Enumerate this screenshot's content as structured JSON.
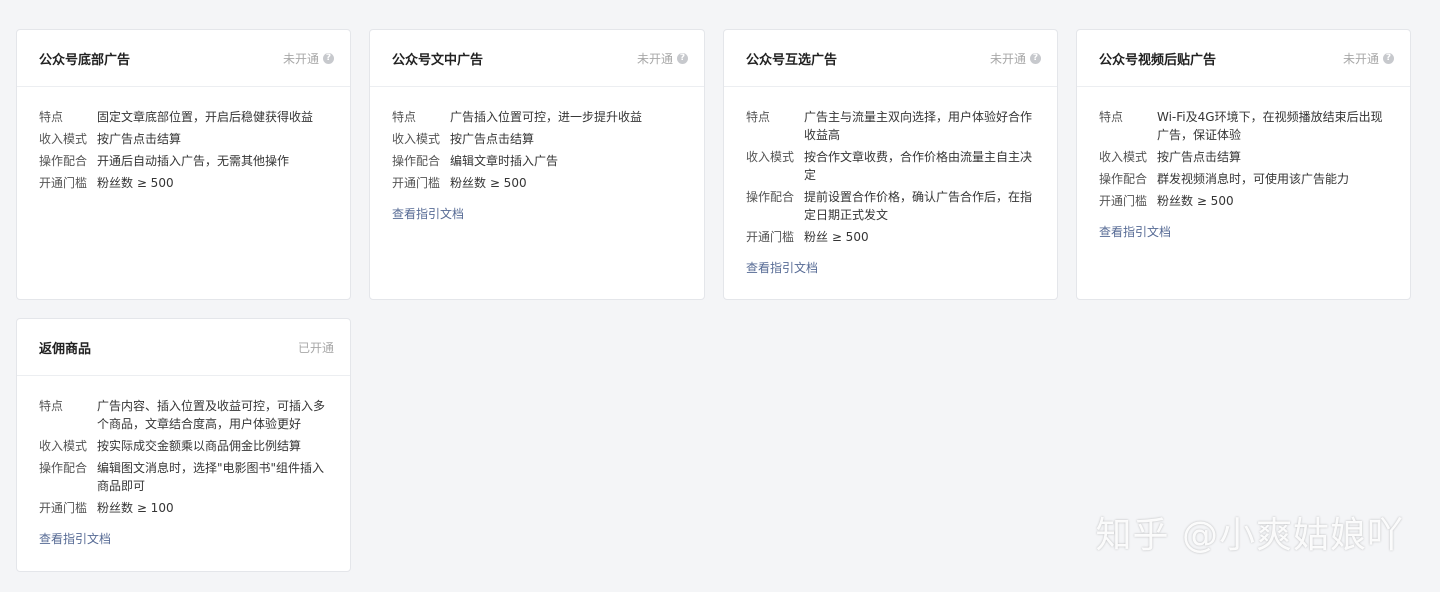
{
  "cards": [
    {
      "title": "公众号底部广告",
      "status": "未开通",
      "rows": [
        {
          "label": "特点",
          "value": "固定文章底部位置，开启后稳健获得收益"
        },
        {
          "label": "收入模式",
          "value": "按广告点击结算"
        },
        {
          "label": "操作配合",
          "value": "开通后自动插入广告，无需其他操作"
        },
        {
          "label": "开通门槛",
          "value": "粉丝数 ≥ 500"
        }
      ],
      "link": ""
    },
    {
      "title": "公众号文中广告",
      "status": "未开通",
      "rows": [
        {
          "label": "特点",
          "value": "广告插入位置可控，进一步提升收益"
        },
        {
          "label": "收入模式",
          "value": "按广告点击结算"
        },
        {
          "label": "操作配合",
          "value": "编辑文章时插入广告"
        },
        {
          "label": "开通门槛",
          "value": "粉丝数 ≥ 500"
        }
      ],
      "link": "查看指引文档"
    },
    {
      "title": "公众号互选广告",
      "status": "未开通",
      "rows": [
        {
          "label": "特点",
          "value": "广告主与流量主双向选择，用户体验好合作收益高"
        },
        {
          "label": "收入模式",
          "value": "按合作文章收费，合作价格由流量主自主决定"
        },
        {
          "label": "操作配合",
          "value": "提前设置合作价格，确认广告合作后，在指定日期正式发文"
        },
        {
          "label": "开通门槛",
          "value": "粉丝 ≥ 500"
        }
      ],
      "link": "查看指引文档"
    },
    {
      "title": "公众号视频后贴广告",
      "status": "未开通",
      "rows": [
        {
          "label": "特点",
          "value": "Wi-Fi及4G环境下，在视频播放结束后出现广告，保证体验"
        },
        {
          "label": "收入模式",
          "value": "按广告点击结算"
        },
        {
          "label": "操作配合",
          "value": "群发视频消息时，可使用该广告能力"
        },
        {
          "label": "开通门槛",
          "value": "粉丝数 ≥ 500"
        }
      ],
      "link": "查看指引文档"
    },
    {
      "title": "返佣商品",
      "status": "已开通",
      "rows": [
        {
          "label": "特点",
          "value": "广告内容、插入位置及收益可控，可插入多个商品，文章结合度高，用户体验更好"
        },
        {
          "label": "收入模式",
          "value": "按实际成交金额乘以商品佣金比例结算"
        },
        {
          "label": "操作配合",
          "value": "编辑图文消息时，选择\"电影图书\"组件插入商品即可"
        },
        {
          "label": "开通门槛",
          "value": "粉丝数 ≥ 100"
        }
      ],
      "link": "查看指引文档"
    }
  ],
  "watermark": "知乎 @小爽姑娘吖",
  "icons": {
    "help": "question-circle-icon"
  },
  "colors": {
    "link": "#576b95",
    "status": "#a8a8a8",
    "background": "#f4f5f7"
  }
}
